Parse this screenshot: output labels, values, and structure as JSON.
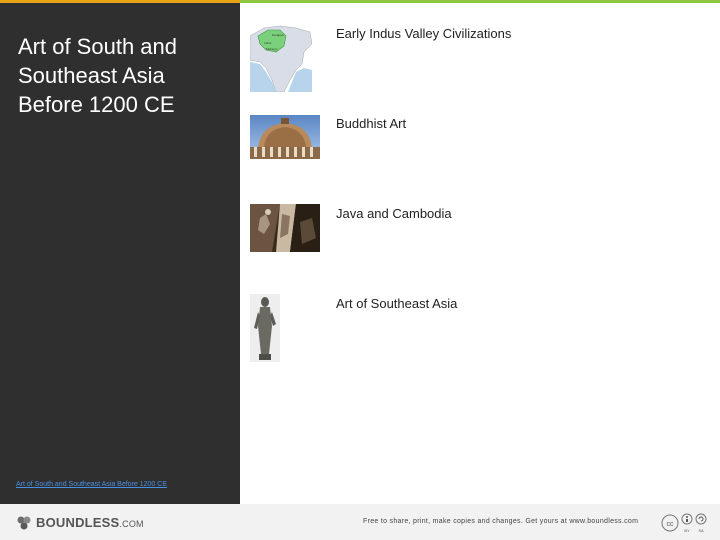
{
  "colors": {
    "accent_orange": "#e8a317",
    "accent_green": "#8dc63f",
    "sidebar_bg": "#2f2f2f",
    "link": "#4a90e2"
  },
  "sidebar": {
    "title": "Art of South and\nSoutheast Asia\nBefore 1200 CE",
    "link": "Art of South and Southeast Asia Before 1200 CE"
  },
  "items": [
    {
      "label": "Early Indus Valley Civilizations",
      "icon": "map-thumbnail"
    },
    {
      "label": "Buddhist Art",
      "icon": "stupa-thumbnail"
    },
    {
      "label": "Java and Cambodia",
      "icon": "relief-thumbnail"
    },
    {
      "label": "Art of Southeast Asia",
      "icon": "statue-thumbnail"
    }
  ],
  "footer": {
    "brand": "BOUNDLESS",
    "brand_suffix": ".COM",
    "note": "Free to share, print, make copies and changes. Get yours at www.boundless.com",
    "license": {
      "cc": "cc",
      "by": "BY",
      "sa": "SA"
    }
  }
}
